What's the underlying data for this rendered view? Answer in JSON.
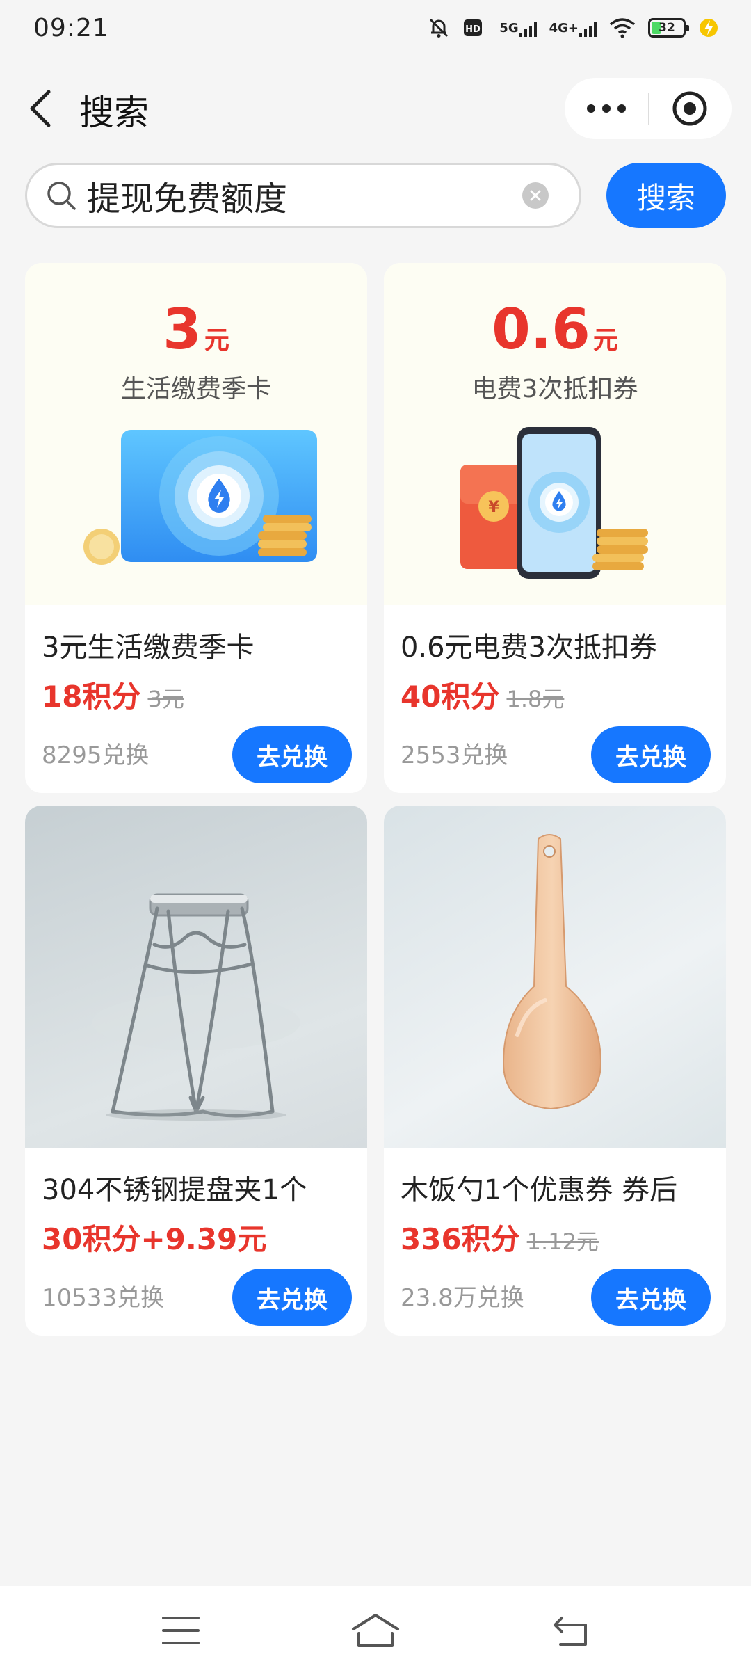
{
  "status_bar": {
    "time": "09:21",
    "hd_label": "HD",
    "signal_5g_label": "5G",
    "signal_4g_label": "4G+",
    "battery_level": "32",
    "battery_fraction": 0.32
  },
  "header": {
    "title": "搜索"
  },
  "search": {
    "query": "提现免费额度",
    "button_label": "搜索"
  },
  "products": [
    {
      "coupon_amount": "3",
      "coupon_unit": "元",
      "coupon_subtitle": "生活缴费季卡",
      "title": "3元生活缴费季卡",
      "price": "18积分",
      "original_price": "3元",
      "exchange_count": "8295兑换",
      "button_label": "去兑换"
    },
    {
      "coupon_amount": "0.6",
      "coupon_unit": "元",
      "coupon_subtitle": "电费3次抵扣券",
      "title": "0.6元电费3次抵扣券",
      "price": "40积分",
      "original_price": "1.8元",
      "exchange_count": "2553兑换",
      "button_label": "去兑换"
    },
    {
      "title": "304不锈钢提盘夹1个",
      "price": "30积分+9.39元",
      "original_price": "",
      "exchange_count": "10533兑换",
      "button_label": "去兑换"
    },
    {
      "title": "木饭勺1个优惠券 券后",
      "price": "336积分",
      "original_price": "1.12元",
      "exchange_count": "23.8万兑换",
      "button_label": "去兑换"
    }
  ],
  "colors": {
    "accent": "#1677ff",
    "price_red": "#e8352c",
    "background": "#f5f5f5",
    "coupon_card_bg": "#fdfdf3"
  }
}
